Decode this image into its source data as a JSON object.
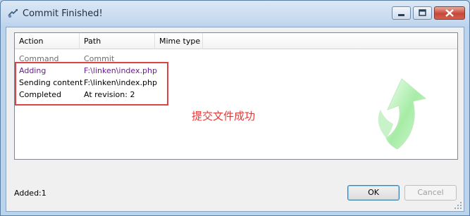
{
  "window": {
    "title": "Commit Finished!",
    "icon": "tortoise-commit-icon"
  },
  "window_buttons": {
    "minimize": "minimize-icon",
    "maximize": "maximize-icon",
    "close": "close-icon"
  },
  "list": {
    "columns": [
      "Action",
      "Path",
      "Mime type"
    ],
    "rows": [
      {
        "action": "Command",
        "path": "Commit",
        "style": "gray"
      },
      {
        "action": "Adding",
        "path": "F:\\linken\\index.php",
        "style": "purple"
      },
      {
        "action": "Sending content",
        "path": "F:\\linken\\index.php",
        "style": "normal"
      },
      {
        "action": "Completed",
        "path": "At revision: 2",
        "style": "normal"
      }
    ]
  },
  "annotation": {
    "text": "提交文件成功",
    "color": "#e53a3a"
  },
  "status": {
    "text": "Added:1"
  },
  "buttons": {
    "ok": "OK",
    "cancel": "Cancel"
  },
  "colors": {
    "titlebar": "#c4d8ee",
    "added_row": "#6a1d8e",
    "annotation_box": "#d94444",
    "arrow_green": "#8ee08e"
  }
}
